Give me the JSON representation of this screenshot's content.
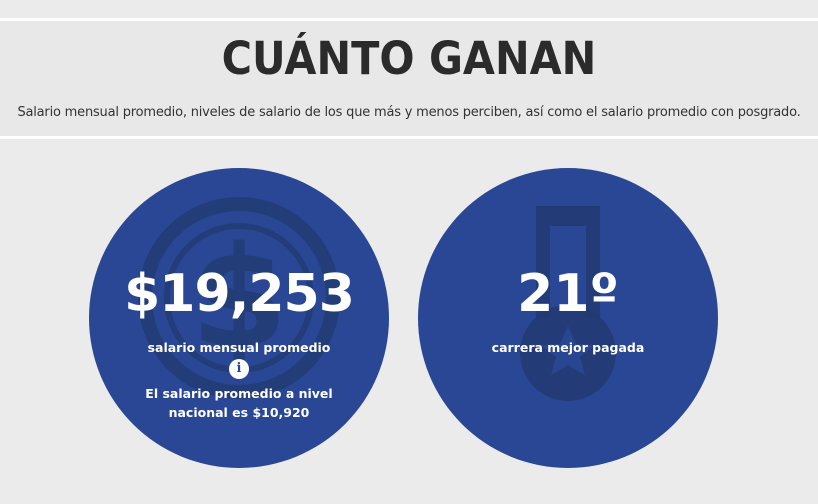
{
  "header": {
    "title": "CUÁNTO GANAN",
    "subtitle": "Salario mensual promedio, niveles de salario de los que más y menos perciben, así como el salario promedio con posgrado."
  },
  "stats": {
    "salary": {
      "value": "$19,253",
      "label": "salario mensual promedio",
      "info_icon": "info-icon",
      "note": "El salario promedio a nivel nacional es $10,920",
      "background_icon": "coin-icon"
    },
    "ranking": {
      "value": "21º",
      "label": "carrera mejor pagada",
      "background_icon": "medal-icon"
    }
  },
  "colors": {
    "circle": "#2a4795",
    "background": "#ebebec",
    "title": "#2b2b2b",
    "text_on_circle": "#ffffff"
  }
}
